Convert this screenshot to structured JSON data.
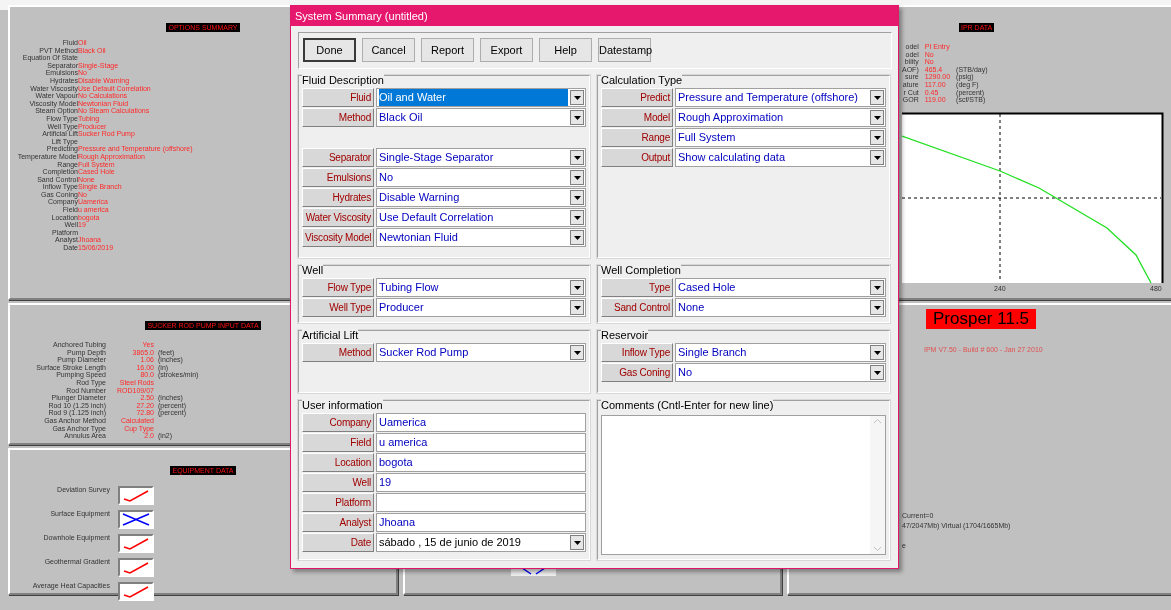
{
  "options_summary": {
    "title": "OPTIONS SUMMARY",
    "rows": [
      {
        "label": "Fluid",
        "value": "Oil"
      },
      {
        "label": "PVT Method",
        "value": "Black Oil"
      },
      {
        "label": "Equation Of State"
      },
      {
        "label": "Separator",
        "value": "Single-Stage"
      },
      {
        "label": "Emulsions",
        "value": "No"
      },
      {
        "label": "Hydrates",
        "value": "Disable Warning"
      },
      {
        "label": "Water Viscosity",
        "value": "Use Default Correlation"
      },
      {
        "label": "Water Vapour",
        "value": "No Calculations"
      },
      {
        "label": "Viscosity Model",
        "value": "Newtonian Fluid"
      },
      {
        "label": "Steam Option",
        "value": "No Steam Calculations"
      },
      {
        "label": "Flow Type",
        "value": "Tubing"
      },
      {
        "label": "Well Type",
        "value": "Producer"
      },
      {
        "label": "Artificial Lift",
        "value": "Sucker Rod Pump"
      },
      {
        "label": "Lift Type"
      },
      {
        "label": "Predicting",
        "value": "Pressure and Temperature (offshore)"
      },
      {
        "label": "Temperature Model",
        "value": "Rough Approximation"
      },
      {
        "label": "Range",
        "value": "Full System"
      },
      {
        "label": "Completion",
        "value": "Cased Hole"
      },
      {
        "label": "Sand Control",
        "value": "None"
      },
      {
        "label": "Inflow Type",
        "value": "Single Branch"
      },
      {
        "label": "Gas Coning",
        "value": "No"
      },
      {
        "label": "Company",
        "value": "Uamerica"
      },
      {
        "label": "Field",
        "value": "u america"
      },
      {
        "label": "Location",
        "value": "bogota"
      },
      {
        "label": "Well",
        "value": "19"
      },
      {
        "label": "Platform"
      },
      {
        "label": "Analyst",
        "value": "Jhoana"
      },
      {
        "label": "Date",
        "value": "15/06/2019"
      }
    ]
  },
  "sucker_rod_pump": {
    "title": "SUCKER ROD PUMP INPUT DATA",
    "rows": [
      {
        "label": "Anchored Tubing",
        "value": "Yes"
      },
      {
        "label": "Pump Depth",
        "value": "3865.0",
        "unit": "(feet)"
      },
      {
        "label": "Pump Diameter",
        "value": "1.06",
        "unit": "(inches)"
      },
      {
        "label": "Surface Stroke Length",
        "value": "16.00",
        "unit": "(in)"
      },
      {
        "label": "Pumping Speed",
        "value": "80.0",
        "unit": "(strokes/min)"
      },
      {
        "label": "Rod Type",
        "value": "Steel Rods"
      },
      {
        "label": "Rod Number",
        "value": "ROD109/07"
      },
      {
        "label": "Plunger Diameter",
        "value": "2.50",
        "unit": "(inches)"
      },
      {
        "label": "Rod 10 (1.25 inch)",
        "value": "27.20",
        "unit": "(percent)"
      },
      {
        "label": "Rod 9 (1.125 inch)",
        "value": "72.80",
        "unit": "(percent)"
      },
      {
        "label": "Gas Anchor Method",
        "value": "Calculated"
      },
      {
        "label": "Gas Anchor Type",
        "value": "Cup Type"
      },
      {
        "label": "Annulus Area",
        "value": "2.0",
        "unit": "(in2)"
      }
    ]
  },
  "equipment_data": {
    "title": "EQUIPMENT DATA",
    "items": [
      {
        "label": "Deviation Survey",
        "done": true
      },
      {
        "label": "Surface Equipment",
        "done": false
      },
      {
        "label": "Downhole Equipment",
        "done": true
      },
      {
        "label": "Geothermal Gradient",
        "done": true
      },
      {
        "label": "Average Heat Capacities",
        "done": true
      }
    ]
  },
  "ipr_data": {
    "title": "IPR DATA",
    "rows": [
      {
        "label": "odel",
        "value": "PI Entry"
      },
      {
        "label": "odel",
        "value": "No"
      },
      {
        "label": "bility",
        "value": "No"
      },
      {
        "label": "AOF)",
        "value": "465.4",
        "unit": "(STB/day)"
      },
      {
        "label": "sure",
        "value": "1290.00",
        "unit": "(psig)"
      },
      {
        "label": "ature",
        "value": "117.00",
        "unit": "(deg F)"
      },
      {
        "label": "r Cut",
        "value": "0.45",
        "unit": "(percent)"
      },
      {
        "label": "GOR",
        "value": "119.00",
        "unit": "(scf/STB)"
      }
    ],
    "x_tick_labels": [
      "240",
      "480"
    ]
  },
  "about": {
    "product": "Prosper 11.5",
    "build": "IPM V7.50 - Build # 600 - Jan 27 2010",
    "status_lines": [
      "Current=0",
      "47/2047Mb) Virtual (1704/1665Mb)",
      "e"
    ]
  },
  "dialog": {
    "title": "System Summary (untitled)",
    "buttons": [
      {
        "label": "Done",
        "default": true
      },
      {
        "label": "Cancel",
        "default": false
      },
      {
        "label": "Report",
        "default": false
      },
      {
        "label": "Export",
        "default": false
      },
      {
        "label": "Help",
        "default": false
      },
      {
        "label": "Datestamp",
        "default": false
      }
    ],
    "groups": [
      {
        "title": "Fluid Description",
        "fields": [
          {
            "label": "Fluid",
            "value": "Oil and Water",
            "kind": "combo",
            "selected": true
          },
          {
            "label": "Method",
            "value": "Black Oil",
            "kind": "combo",
            "selected": false
          },
          {
            "label": "Separator",
            "value": "Single-Stage Separator",
            "kind": "combo",
            "selected": false
          },
          {
            "label": "Emulsions",
            "value": "No",
            "kind": "combo",
            "selected": false
          },
          {
            "label": "Hydrates",
            "value": "Disable Warning",
            "kind": "combo",
            "selected": false
          },
          {
            "label": "Water Viscosity",
            "value": "Use Default Correlation",
            "kind": "combo",
            "selected": false
          },
          {
            "label": "Viscosity Model",
            "value": "Newtonian Fluid",
            "kind": "combo",
            "selected": false
          }
        ]
      },
      {
        "title": "Calculation Type",
        "fields": [
          {
            "label": "Predict",
            "value": "Pressure and Temperature (offshore)",
            "kind": "combo",
            "selected": false
          },
          {
            "label": "Model",
            "value": "Rough Approximation",
            "kind": "combo",
            "selected": false
          },
          {
            "label": "Range",
            "value": "Full System",
            "kind": "combo",
            "selected": false
          },
          {
            "label": "Output",
            "value": "Show calculating data",
            "kind": "combo",
            "selected": false
          }
        ]
      },
      {
        "title": "Well",
        "fields": [
          {
            "label": "Flow Type",
            "value": "Tubing Flow",
            "kind": "combo",
            "selected": false
          },
          {
            "label": "Well Type",
            "value": "Producer",
            "kind": "combo",
            "selected": false
          }
        ]
      },
      {
        "title": "Well Completion",
        "fields": [
          {
            "label": "Type",
            "value": "Cased Hole",
            "kind": "combo",
            "selected": false
          },
          {
            "label": "Sand Control",
            "value": "None",
            "kind": "combo",
            "selected": false
          }
        ]
      },
      {
        "title": "Artificial Lift",
        "fields": [
          {
            "label": "Method",
            "value": "Sucker Rod Pump",
            "kind": "combo",
            "selected": false
          }
        ]
      },
      {
        "title": "Reservoir",
        "fields": [
          {
            "label": "Inflow Type",
            "value": "Single Branch",
            "kind": "combo",
            "selected": false
          },
          {
            "label": "Gas Coning",
            "value": "No",
            "kind": "combo",
            "selected": false
          }
        ]
      },
      {
        "title": "User information",
        "fields": [
          {
            "label": "Company",
            "value": "Uamerica",
            "kind": "text"
          },
          {
            "label": "Field",
            "value": "u america",
            "kind": "text"
          },
          {
            "label": "Location",
            "value": "bogota",
            "kind": "text"
          },
          {
            "label": "Well",
            "value": "19",
            "kind": "text"
          },
          {
            "label": "Platform",
            "kind": "text"
          },
          {
            "label": "Analyst",
            "value": "Jhoana",
            "kind": "text"
          },
          {
            "label": "Date",
            "value": "sábado , 15 de   junio   de 2019",
            "kind": "date"
          }
        ]
      },
      {
        "title": "Comments (Cntl-Enter for new line)",
        "kind": "comments"
      }
    ]
  }
}
